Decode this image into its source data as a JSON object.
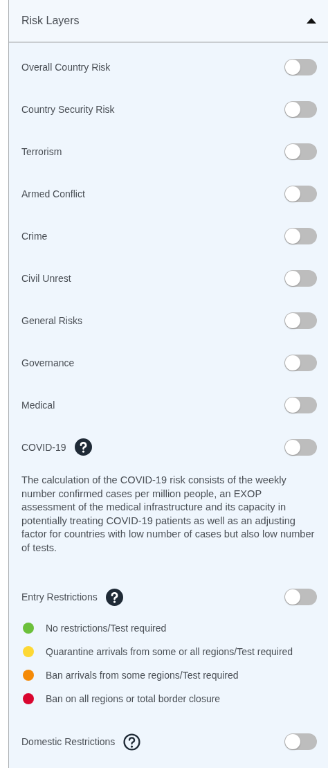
{
  "panel": {
    "title": "Risk Layers",
    "expanded": true
  },
  "layers": [
    {
      "kind": "toggle",
      "label": "Overall Country Risk",
      "on": false
    },
    {
      "kind": "toggle",
      "label": "Country Security Risk",
      "on": false
    },
    {
      "kind": "toggle",
      "label": "Terrorism",
      "on": false
    },
    {
      "kind": "toggle",
      "label": "Armed Conflict",
      "on": false
    },
    {
      "kind": "toggle",
      "label": "Crime",
      "on": false
    },
    {
      "kind": "toggle",
      "label": "Civil Unrest",
      "on": false
    },
    {
      "kind": "toggle",
      "label": "General Risks",
      "on": false
    },
    {
      "kind": "toggle",
      "label": "Governance",
      "on": false
    },
    {
      "kind": "toggle",
      "label": "Medical",
      "on": false
    },
    {
      "kind": "toggle",
      "label": "COVID-19",
      "on": false,
      "help": true,
      "help_filled": true,
      "description": "The calculation of the COVID-19 risk consists of the weekly number confirmed cases per million people, an EXOP assessment of the medical infrastructure and its capacity in potentially treating COVID-19 patients as well as an adjusting factor for countries with low number of cases but also low number of tests."
    },
    {
      "kind": "toggle",
      "label": "Entry Restrictions",
      "on": false,
      "help": true,
      "help_filled": true,
      "legend": [
        {
          "label": "No restrictions/Test required",
          "color": "#6cc03b"
        },
        {
          "label": "Quarantine arrivals from some or all regions/Test required",
          "color": "#fdd835"
        },
        {
          "label": "Ban arrivals from some regions/Test required",
          "color": "#f58a07"
        },
        {
          "label": "Ban on all regions or total border closure",
          "color": "#d9062f"
        }
      ]
    },
    {
      "kind": "toggle",
      "label": "Domestic Restrictions",
      "on": false,
      "help": true,
      "help_filled": false
    }
  ]
}
